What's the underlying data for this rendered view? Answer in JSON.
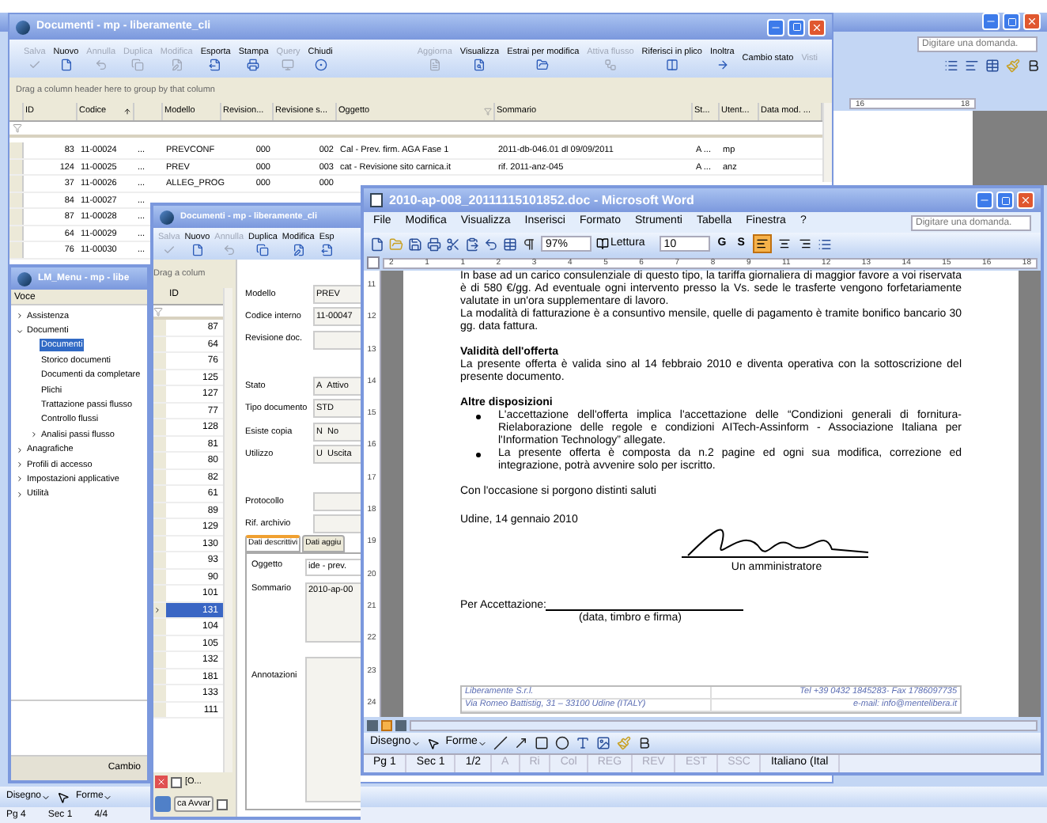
{
  "back_word": {
    "question_placeholder": "Digitare una domanda.",
    "ruler": [
      "16",
      "18"
    ],
    "drawing_toolbar": [
      "Disegno",
      "Forme"
    ],
    "status": [
      "Pg 4",
      "Sec 1",
      "4/4"
    ]
  },
  "documenti": {
    "title": "Documenti - mp - liberamente_cli",
    "toolbar": [
      {
        "label": "Salva",
        "disabled": true
      },
      {
        "label": "Nuovo",
        "disabled": false
      },
      {
        "label": "Annulla",
        "disabled": true
      },
      {
        "label": "Duplica",
        "disabled": true
      },
      {
        "label": "Modifica",
        "disabled": true
      },
      {
        "label": "Esporta",
        "disabled": false
      },
      {
        "label": "Stampa",
        "disabled": false
      },
      {
        "label": "Query",
        "disabled": true
      },
      {
        "label": "Chiudi",
        "disabled": false
      }
    ],
    "toolbar_right": [
      {
        "label": "Aggiorna",
        "disabled": true
      },
      {
        "label": "Visualizza",
        "disabled": false
      },
      {
        "label": "Estrai per modifica",
        "disabled": false
      },
      {
        "label": "Attiva flusso",
        "disabled": true
      },
      {
        "label": "Riferisci in plico",
        "disabled": false
      },
      {
        "label": "Inoltra",
        "disabled": false
      },
      {
        "label": "Cambio stato",
        "disabled": false
      },
      {
        "label": "Visti",
        "disabled": true
      }
    ],
    "group_hint": "Drag a column header here to group by that column",
    "columns": [
      {
        "label": "ID",
        "sorted": false,
        "filtered": false
      },
      {
        "label": "Codice",
        "sorted": true,
        "filtered": false
      },
      {
        "sorted": false,
        "filtered": false
      },
      {
        "label": "Modello",
        "sorted": false,
        "filtered": false
      },
      {
        "label": "Revision...",
        "sorted": false,
        "filtered": false
      },
      {
        "label": "Revisione s...",
        "sorted": false,
        "filtered": false
      },
      {
        "label": "Oggetto",
        "sorted": false,
        "filtered": true
      },
      {
        "label": "Sommario",
        "sorted": false,
        "filtered": false
      },
      {
        "label": "St...",
        "sorted": false,
        "filtered": false
      },
      {
        "label": "Utent...",
        "sorted": false,
        "filtered": false
      },
      {
        "label": "Data mod. ...",
        "sorted": false,
        "filtered": false
      }
    ],
    "rows": [
      {
        "cells": [
          "83",
          "11-00024",
          "...",
          "PREVCONF",
          "000",
          "002",
          "Cal - Prev. firm. AGA Fase 1",
          "2011-db-046.01 dl 09/09/2011",
          "A ...",
          "mp"
        ]
      },
      {
        "cells": [
          "124",
          "11-00025",
          "...",
          "PREV",
          "000",
          "003",
          "cat - Revisione sito carnica.it",
          "rif. 2011-anz-045",
          "A ...",
          "anz"
        ]
      },
      {
        "cells": [
          "37",
          "11-00026",
          "...",
          "ALLEG_PROG",
          "000",
          "000"
        ]
      },
      {
        "cells": [
          "84",
          "11-00027",
          "..."
        ]
      },
      {
        "cells": [
          "87",
          "11-00028",
          "..."
        ]
      },
      {
        "cells": [
          "64",
          "11-00029",
          "..."
        ]
      },
      {
        "cells": [
          "76",
          "11-00030",
          "..."
        ]
      }
    ]
  },
  "lm_menu": {
    "title": "LM_Menu - mp - libe",
    "header": "Voce",
    "tree": [
      {
        "label": "Assistenza",
        "selected": false,
        "expanded": false
      },
      {
        "label": "Documenti",
        "selected": false,
        "expanded": true,
        "children": [
          {
            "label": "Documenti",
            "selected": true
          },
          {
            "label": "Storico documenti",
            "selected": false
          },
          {
            "label": "Documenti da completare",
            "selected": false
          },
          {
            "label": "Plichi",
            "selected": false
          },
          {
            "label": "Trattazione passi flusso",
            "selected": false
          },
          {
            "label": "Controllo flussi",
            "selected": false
          },
          {
            "label": "Analisi passi flusso",
            "selected": false,
            "expanded": false
          }
        ]
      },
      {
        "label": "Anagrafiche",
        "selected": false,
        "expanded": false
      },
      {
        "label": "Profili di accesso",
        "selected": false,
        "expanded": false
      },
      {
        "label": "Impostazioni applicative",
        "selected": false,
        "expanded": false
      },
      {
        "label": "Utilità",
        "selected": false,
        "expanded": false
      }
    ],
    "button": "Cambio"
  },
  "documenti2": {
    "title": "Documenti - mp - liberamente_cli",
    "toolbar": [
      {
        "label": "Salva",
        "disabled": true
      },
      {
        "label": "Nuovo",
        "disabled": false
      },
      {
        "label": "Annulla",
        "disabled": true
      },
      {
        "label": "Duplica",
        "disabled": false
      },
      {
        "label": "Modifica",
        "disabled": false
      },
      {
        "label": "Esp",
        "disabled": false
      }
    ],
    "group_hint": "Drag a colum",
    "id_header": "ID",
    "ids": [
      {
        "id": "87",
        "selected": false
      },
      {
        "id": "64",
        "selected": false
      },
      {
        "id": "76",
        "selected": false
      },
      {
        "id": "125",
        "selected": false
      },
      {
        "id": "127",
        "selected": false
      },
      {
        "id": "77",
        "selected": false
      },
      {
        "id": "128",
        "selected": false
      },
      {
        "id": "81",
        "selected": false
      },
      {
        "id": "80",
        "selected": false
      },
      {
        "id": "82",
        "selected": false
      },
      {
        "id": "61",
        "selected": false
      },
      {
        "id": "89",
        "selected": false
      },
      {
        "id": "129",
        "selected": false
      },
      {
        "id": "130",
        "selected": false
      },
      {
        "id": "93",
        "selected": false
      },
      {
        "id": "90",
        "selected": false
      },
      {
        "id": "101",
        "selected": false
      },
      {
        "id": "131",
        "selected": true
      },
      {
        "id": "104",
        "selected": false
      },
      {
        "id": "105",
        "selected": false
      },
      {
        "id": "132",
        "selected": false
      },
      {
        "id": "181",
        "selected": false
      },
      {
        "id": "133",
        "selected": false
      },
      {
        "id": "111",
        "selected": false
      }
    ],
    "fields": [
      {
        "label": "Modello",
        "values": [
          "PREV"
        ]
      },
      {
        "label": "Codice interno",
        "values": [
          "11-00047"
        ]
      },
      {
        "label": "Revisione doc."
      },
      {
        "label": "Stato",
        "values": [
          "A",
          "Attivo"
        ]
      },
      {
        "label": "Tipo documento",
        "values": [
          "STD"
        ]
      },
      {
        "label": "Esiste copia",
        "values": [
          "N",
          "No"
        ]
      },
      {
        "label": "Utilizzo",
        "values": [
          "U",
          "Uscita"
        ]
      },
      {
        "label": "Protocollo"
      },
      {
        "label": "Rif. archivio"
      }
    ],
    "tabs": [
      {
        "label": "Dati descrittivi",
        "selected": true
      },
      {
        "label": "Dati aggiu",
        "selected": false
      }
    ],
    "oggetto": {
      "label": "Oggetto",
      "value": "ide - prev."
    },
    "sommario": {
      "label": "Sommario",
      "value": "2010-ap-00"
    },
    "annotazioni": {
      "label": "Annotazioni"
    },
    "filter_text": "[O...",
    "checkboxes": [
      {
        "checked": false
      },
      {
        "checked": false
      }
    ],
    "button": "ca Avvar"
  },
  "word": {
    "title": "2010-ap-008_20111115101852.doc - Microsoft Word",
    "menu": [
      "File",
      "Modifica",
      "Visualizza",
      "Inserisci",
      "Formato",
      "Strumenti",
      "Tabella",
      "Finestra",
      "?"
    ],
    "question_placeholder": "Digitare una domanda.",
    "zoom": "97%",
    "reading": "Lettura",
    "font_size": "10",
    "bold": "G",
    "underline": "S",
    "align": [
      {
        "selected": true
      },
      {
        "selected": false
      },
      {
        "selected": false
      }
    ],
    "ruler": [
      "2",
      "1",
      "1",
      "2",
      "3",
      "4",
      "5",
      "6",
      "7",
      "8",
      "9",
      "11",
      "12",
      "13",
      "14",
      "15",
      "16",
      "18"
    ],
    "vruler": [
      "11",
      "12",
      "13",
      "14",
      "15",
      "16",
      "17",
      "18",
      "19",
      "20",
      "21",
      "22",
      "23",
      "24"
    ],
    "blocks": [
      {
        "kind": "paragraph",
        "text": "In base ad un carico consulenziale di questo tipo, la tariffa giornaliera di maggior favore a voi riservata è di 580 €/gg. Ad eventuale ogni intervento presso la Vs. sede le trasferte vengono forfetariamente valutate in un'ora supplementare di lavoro."
      },
      {
        "kind": "paragraph",
        "text": "La modalità di fatturazione è a consuntivo mensile, quelle di pagamento è tramite bonifico bancario 30 gg. data fattura."
      },
      {
        "kind": "heading",
        "text": "Validità dell'offerta"
      },
      {
        "kind": "paragraph",
        "text": "La presente offerta è valida sino al 14 febbraio 2010 e diventa operativa con la sottoscrizione del presente documento."
      },
      {
        "kind": "heading",
        "text": "Altre disposizioni"
      },
      {
        "kind": "bullet",
        "text": "L'accettazione dell'offerta implica l'accettazione delle “Condizioni generali di fornitura-Rielaborazione delle regole e condizioni AITech-Assinform - Associazione Italiana per l'Information Technology” allegate."
      },
      {
        "kind": "bullet",
        "text": "La presente offerta è composta da n.2 pagine ed ogni sua modifica, correzione ed integrazione, potrà avvenire solo per iscritto."
      },
      {
        "kind": "closing",
        "text": "Con l'occasione si porgono distinti saluti"
      }
    ],
    "place_date": "Udine, 14 gennaio 2010",
    "signer": "Un amministratore",
    "acceptance": "Per Accettazione:",
    "acceptance_note": "(data, timbro e firma)",
    "footer": [
      [
        "Liberamente S.r.l.",
        "Tel +39 0432 1845283- Fax 1786097735"
      ],
      [
        "Via Romeo Battistig, 31 – 33100 Udine (ITALY)",
        "e-mail: info@mentelibera.it"
      ]
    ],
    "drawing_toolbar": [
      "Disegno",
      "Forme"
    ],
    "status": [
      {
        "text": "Pg 1",
        "disabled": false
      },
      {
        "text": "Sec 1",
        "disabled": false
      },
      {
        "text": "1/2",
        "disabled": false
      },
      {
        "text": "A",
        "disabled": true
      },
      {
        "text": "Ri",
        "disabled": true
      },
      {
        "text": "Col",
        "disabled": true
      },
      {
        "text": "REG",
        "disabled": true
      },
      {
        "text": "REV",
        "disabled": true
      },
      {
        "text": "EST",
        "disabled": true
      },
      {
        "text": "SSC",
        "disabled": true
      },
      {
        "text": "Italiano (Ital",
        "disabled": false
      }
    ]
  }
}
